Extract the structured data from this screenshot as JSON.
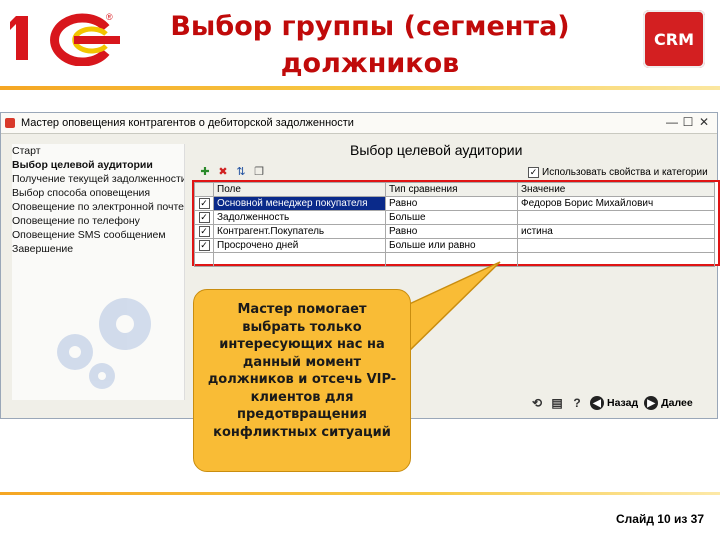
{
  "slide": {
    "title": "Выбор группы (сегмента) должников",
    "logo_text": "1С",
    "badge": "CRM",
    "number": "Слайд 10 из 37",
    "accent_color": "#c00a0a",
    "callout_color": "#f9bc36"
  },
  "window": {
    "title": "Мастер оповещения контрагентов о дебиторской задолженности",
    "buttons": [
      "—",
      "☐",
      "✕"
    ]
  },
  "wizard_steps": [
    "Старт",
    "Выбор целевой аудитории",
    "Получение текущей задолженности",
    "Выбор способа оповещения",
    "Оповещение по электронной почте",
    "Оповещение по телефону",
    "Оповещение SMS сообщением",
    "Завершение"
  ],
  "active_step": 1,
  "panel": {
    "title": "Выбор целевой аудитории",
    "use_properties": "Использовать свойства и категории",
    "use_properties_checked": true
  },
  "toolbar_icons": [
    "add-icon",
    "delete-icon",
    "move-icon",
    "copy-icon"
  ],
  "filter_table": {
    "columns": [
      "Поле",
      "Тип сравнения",
      "Значение"
    ],
    "rows": [
      {
        "checked": true,
        "field": "Основной менеджер покупателя",
        "comparison": "Равно",
        "value": "Федоров Борис Михайлович",
        "selected": true
      },
      {
        "checked": true,
        "field": "Задолженность",
        "comparison": "Больше",
        "value": "",
        "selected": false
      },
      {
        "checked": true,
        "field": "Контрагент.Покупатель",
        "comparison": "Равно",
        "value": "истина",
        "selected": false
      },
      {
        "checked": true,
        "field": "Просрочено дней",
        "comparison": "Больше или равно",
        "value": "",
        "selected": false
      }
    ]
  },
  "footer": {
    "icons": [
      "refresh-icon",
      "print-icon",
      "help-icon"
    ],
    "back": "Назад",
    "next": "Далее"
  },
  "callout": {
    "text": "Мастер помогает выбрать только интересующих нас на данный момент должников и отсечь VIP-клиентов для предотвращения конфликтных ситуаций"
  }
}
